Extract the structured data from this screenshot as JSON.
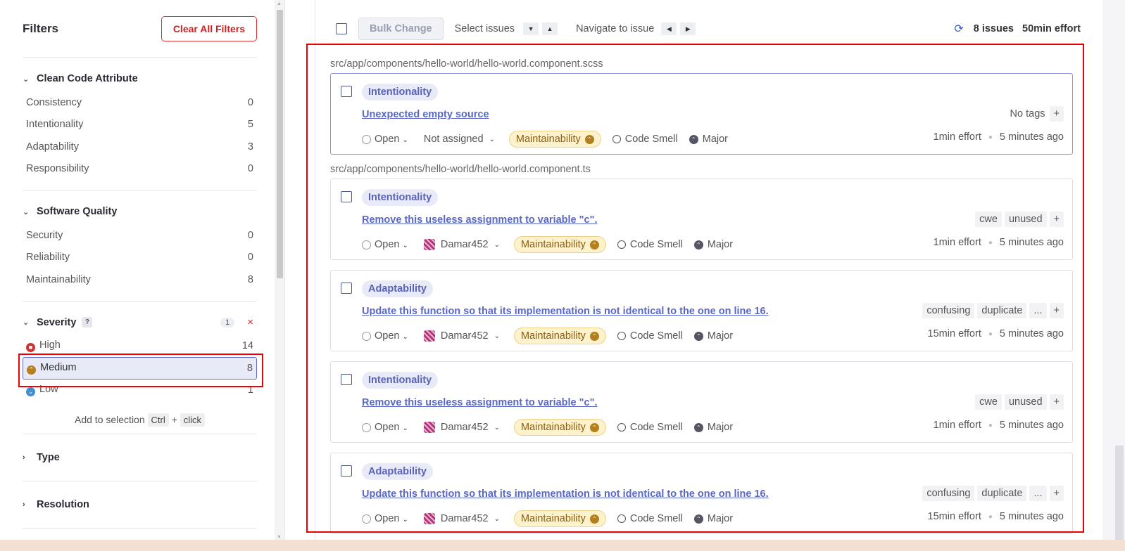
{
  "sidebar": {
    "title": "Filters",
    "clear_label": "Clear All Filters",
    "clean_code": {
      "title": "Clean Code Attribute",
      "items": [
        {
          "label": "Consistency",
          "count": "0"
        },
        {
          "label": "Intentionality",
          "count": "5"
        },
        {
          "label": "Adaptability",
          "count": "3"
        },
        {
          "label": "Responsibility",
          "count": "0"
        }
      ]
    },
    "software_quality": {
      "title": "Software Quality",
      "items": [
        {
          "label": "Security",
          "count": "0"
        },
        {
          "label": "Reliability",
          "count": "0"
        },
        {
          "label": "Maintainability",
          "count": "8"
        }
      ]
    },
    "severity": {
      "title": "Severity",
      "help": "?",
      "selected_count": "1",
      "clear_icon": "×",
      "items": [
        {
          "label": "High",
          "count": "14",
          "color": "#d0322f"
        },
        {
          "label": "Medium",
          "count": "8",
          "color": "#b47f1f"
        },
        {
          "label": "Low",
          "count": "1",
          "color": "#3e8fd3"
        }
      ],
      "add_selection": "Add to selection",
      "key1": "Ctrl",
      "plus": "+",
      "key2": "click"
    },
    "type_title": "Type",
    "resolution_title": "Resolution"
  },
  "toolbar": {
    "bulk_change": "Bulk Change",
    "select_issues": "Select issues",
    "navigate": "Navigate to issue",
    "issues_count": "8 issues",
    "effort": "50min effort"
  },
  "issues": {
    "path1": "src/app/components/hello-world/hello-world.component.scss",
    "path2": "src/app/components/hello-world/hello-world.component.ts",
    "list": [
      {
        "attr": "Intentionality",
        "title": "Unexpected empty source",
        "no_tags": "No tags",
        "status": "Open",
        "assignee": "Not assigned",
        "quality": "Maintainability",
        "type": "Code Smell",
        "severity": "Major",
        "effort": "1min effort",
        "time": "5 minutes ago"
      },
      {
        "attr": "Intentionality",
        "title": "Remove this useless assignment to variable \"c\".",
        "tags": [
          "cwe",
          "unused"
        ],
        "status": "Open",
        "assignee": "Damar452",
        "quality": "Maintainability",
        "type": "Code Smell",
        "severity": "Major",
        "effort": "1min effort",
        "time": "5 minutes ago"
      },
      {
        "attr": "Adaptability",
        "title": "Update this function so that its implementation is not identical to the one on line 16.",
        "tags": [
          "confusing",
          "duplicate",
          "..."
        ],
        "status": "Open",
        "assignee": "Damar452",
        "quality": "Maintainability",
        "type": "Code Smell",
        "severity": "Major",
        "effort": "15min effort",
        "time": "5 minutes ago"
      },
      {
        "attr": "Intentionality",
        "title": "Remove this useless assignment to variable \"c\".",
        "tags": [
          "cwe",
          "unused"
        ],
        "status": "Open",
        "assignee": "Damar452",
        "quality": "Maintainability",
        "type": "Code Smell",
        "severity": "Major",
        "effort": "1min effort",
        "time": "5 minutes ago"
      },
      {
        "attr": "Adaptability",
        "title": "Update this function so that its implementation is not identical to the one on line 16.",
        "tags": [
          "confusing",
          "duplicate",
          "..."
        ],
        "status": "Open",
        "assignee": "Damar452",
        "quality": "Maintainability",
        "type": "Code Smell",
        "severity": "Major",
        "effort": "15min effort",
        "time": "5 minutes ago"
      }
    ]
  },
  "plus_tag": "+"
}
